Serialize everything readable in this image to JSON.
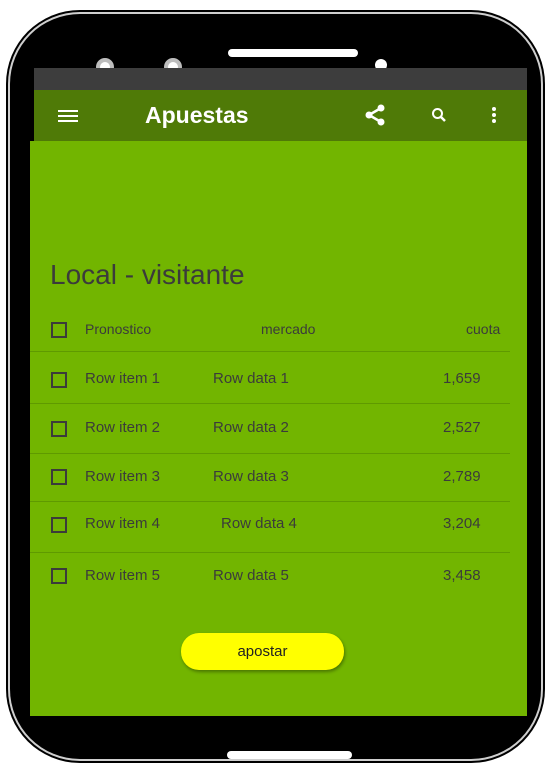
{
  "app": {
    "title": "Apuestas",
    "accent": "#72b500",
    "toolbar_color": "#4f7a07",
    "button_color": "#ffff00"
  },
  "toolbar": {
    "icons": [
      "menu-icon",
      "share-icon",
      "search-icon",
      "more-vert-icon"
    ]
  },
  "match": {
    "title": "Local - visitante"
  },
  "table": {
    "headers": {
      "pronostico": "Pronostico",
      "mercado": "mercado",
      "cuota": "cuota"
    },
    "rows": [
      {
        "item": "Row item 1",
        "data": "Row data 1",
        "cuota": "1,659"
      },
      {
        "item": "Row item 2",
        "data": "Row data 2",
        "cuota": "2,527"
      },
      {
        "item": "Row item 3",
        "data": "Row data 3",
        "cuota": "2,789"
      },
      {
        "item": "Row item 4",
        "data": "Row data 4",
        "cuota": "3,204"
      },
      {
        "item": "Row item 5",
        "data": "Row data 5",
        "cuota": "3,458"
      }
    ]
  },
  "actions": {
    "apostar_label": "apostar"
  }
}
